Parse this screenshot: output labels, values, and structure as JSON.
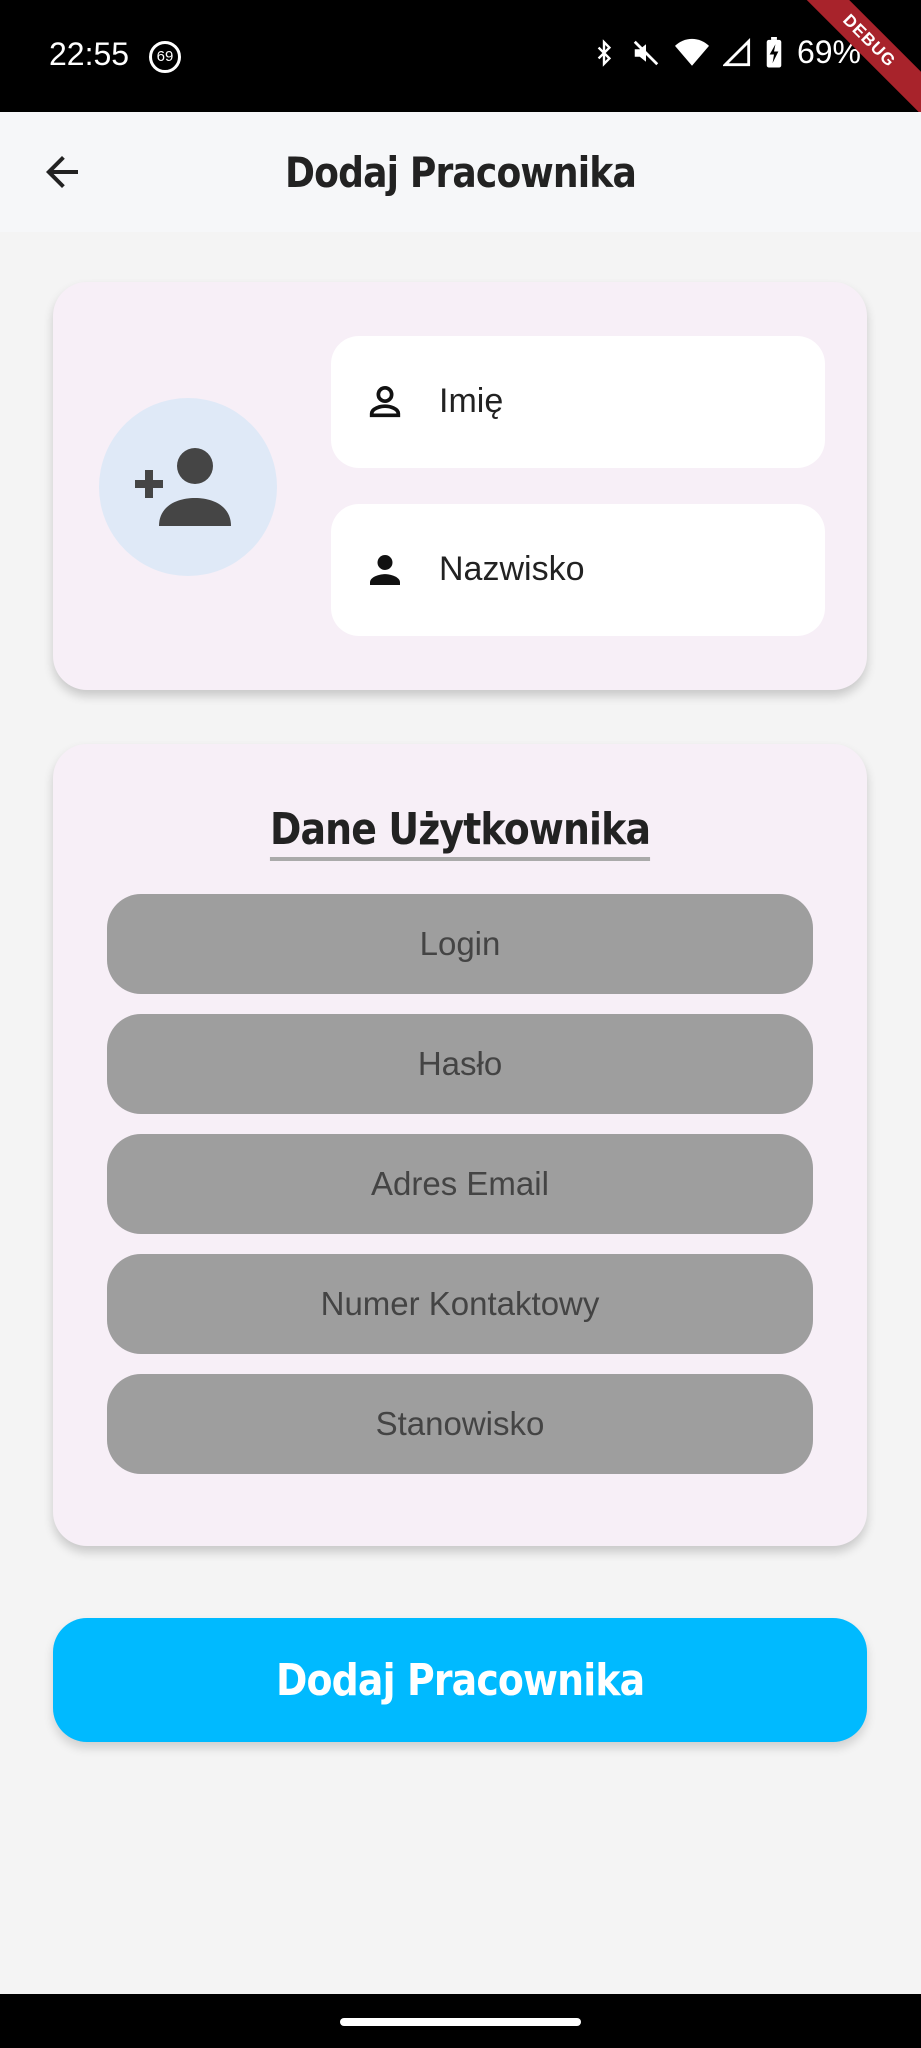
{
  "status_bar": {
    "time": "22:55",
    "notification_badge": "69",
    "battery_percent": "69%",
    "icons": [
      "bluetooth-icon",
      "mute-icon",
      "wifi-icon",
      "signal-icon",
      "battery-charging-icon"
    ],
    "debug_banner": "DEBUG"
  },
  "app_bar": {
    "title": "Dodaj Pracownika",
    "back_icon": "arrow-back-icon"
  },
  "name_card": {
    "avatar_icon": "person-add-icon",
    "first_name_placeholder": "Imię",
    "last_name_placeholder": "Nazwisko"
  },
  "user_card": {
    "title": "Dane Użytkownika",
    "fields": {
      "login": "Login",
      "password": "Hasło",
      "email": "Adres Email",
      "phone": "Numer Kontaktowy",
      "position": "Stanowisko"
    }
  },
  "submit_button": {
    "label": "Dodaj Pracownika"
  },
  "colors": {
    "accent": "#00baff",
    "card_background": "#f7eff7",
    "field_gray": "#9e9e9e",
    "avatar_background": "#dfe9f7",
    "debug_ribbon": "#a8232b"
  }
}
